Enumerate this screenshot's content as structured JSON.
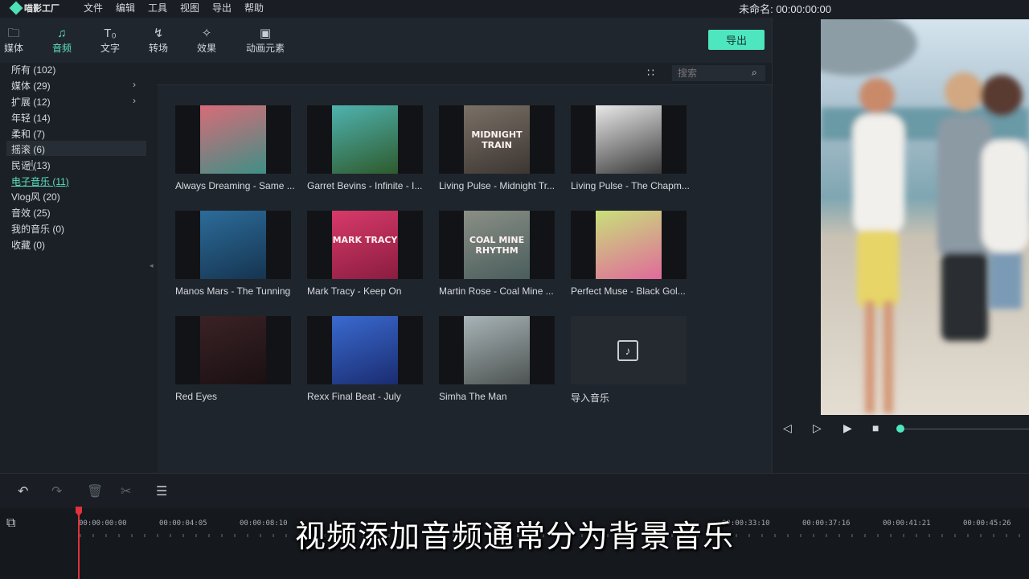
{
  "app": {
    "logo_text": "喵影工厂",
    "title": "未命名: 00:00:00:00"
  },
  "menu": [
    "文件",
    "编辑",
    "工具",
    "视图",
    "导出",
    "帮助"
  ],
  "tools": [
    {
      "label": "媒体",
      "icon": "folder-icon"
    },
    {
      "label": "音频",
      "icon": "music-note-icon"
    },
    {
      "label": "文字",
      "icon": "text-icon"
    },
    {
      "label": "转场",
      "icon": "transition-icon"
    },
    {
      "label": "效果",
      "icon": "effects-icon"
    },
    {
      "label": "动画元素",
      "icon": "image-icon"
    }
  ],
  "export_label": "导出",
  "categories": [
    {
      "label": "所有 (102)"
    },
    {
      "label": "媒体 (29)"
    },
    {
      "label": "扩展 (12)"
    },
    {
      "label": "年轻 (14)"
    },
    {
      "label": "柔和 (7)"
    },
    {
      "label": "摇滚 (6)"
    },
    {
      "label": "民谣 (13)"
    },
    {
      "label": "电子音乐 (11)"
    },
    {
      "label": "Vlog风 (20)"
    },
    {
      "label": "音效 (25)"
    },
    {
      "label": "我的音乐 (0)"
    },
    {
      "label": "收藏 (0)"
    }
  ],
  "search": {
    "placeholder": "搜索"
  },
  "tracks": [
    {
      "label": "Always Dreaming - Same ...",
      "colors": [
        "#d86c78",
        "#3f8f86"
      ]
    },
    {
      "label": "Garret Bevins - Infinite - I...",
      "colors": [
        "#4fb3b0",
        "#2e5a2c"
      ]
    },
    {
      "label": "Living Pulse - Midnight Tr...",
      "colors": [
        "#7a7066",
        "#3c3632"
      ],
      "art_text": "MIDNIGHT TRAIN"
    },
    {
      "label": "Living Pulse - The Chapm...",
      "colors": [
        "#e8e8e8",
        "#3a3a3a"
      ]
    },
    {
      "label": "Manos Mars - The Tunning",
      "colors": [
        "#2c6c9a",
        "#163450"
      ]
    },
    {
      "label": "Mark Tracy - Keep On",
      "colors": [
        "#d83a6a",
        "#8a1c40"
      ],
      "art_text": "MARK TRACY"
    },
    {
      "label": "Martin Rose - Coal Mine ...",
      "colors": [
        "#8a8f86",
        "#4a5d5c"
      ],
      "art_text": "COAL MINE RHYTHM"
    },
    {
      "label": "Perfect Muse - Black Gol...",
      "colors": [
        "#c8e07a",
        "#e06a9a"
      ]
    },
    {
      "label": "Red Eyes",
      "colors": [
        "#3a2226",
        "#1a1012"
      ]
    },
    {
      "label": "Rexx Final Beat - July",
      "colors": [
        "#3a6ad0",
        "#1a2c70"
      ]
    },
    {
      "label": "Simha The Man",
      "colors": [
        "#a8b4b8",
        "#4c5250"
      ]
    }
  ],
  "import_label": "导入音乐",
  "timecodes": [
    "00:00:00:00",
    "00:00:04:05",
    "00:00:08:10",
    "00:00:33:10",
    "00:00:37:16",
    "00:00:41:21",
    "00:00:45:26"
  ],
  "subtitle": "视频添加音频通常分为背景音乐"
}
